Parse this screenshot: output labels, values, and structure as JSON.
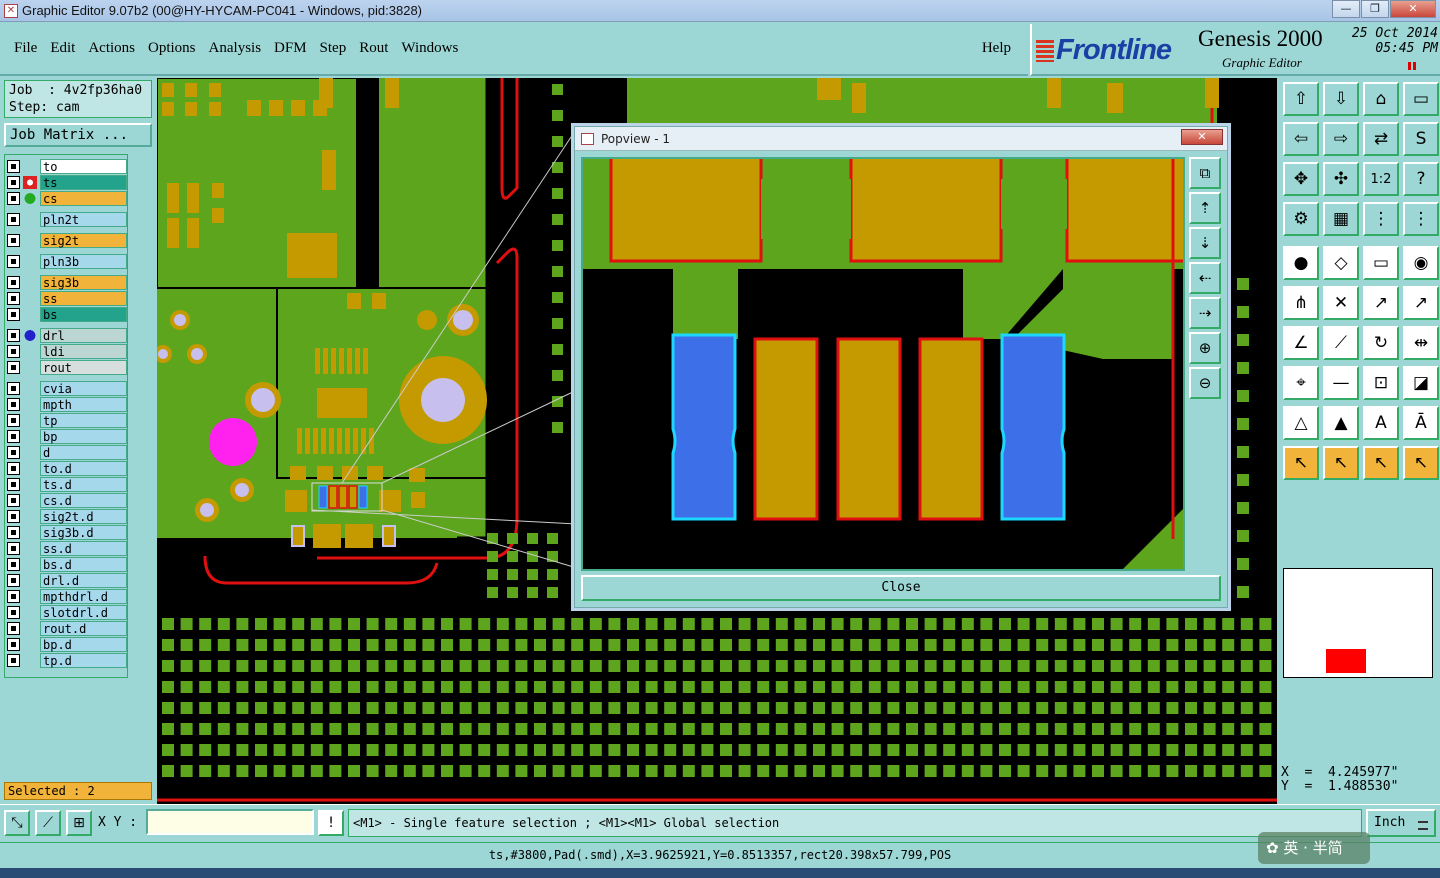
{
  "window": {
    "title": "Graphic Editor 9.07b2 (00@HY-HYCAM-PC041 - Windows, pid:3828)",
    "min": "—",
    "max": "❐",
    "close": "✕"
  },
  "menu": {
    "file": "File",
    "edit": "Edit",
    "actions": "Actions",
    "options": "Options",
    "analysis": "Analysis",
    "dfm": "DFM",
    "step": "Step",
    "rout": "Rout",
    "windows": "Windows",
    "help": "Help"
  },
  "brand": {
    "logo": "Frontline",
    "product": "Genesis 2000",
    "subtitle": "Graphic Editor",
    "date": "25 Oct 2014",
    "time": "05:45 PM"
  },
  "job": {
    "job_line": "Job  : 4v2fp36ha0",
    "step_line": "Step: cam",
    "matrix_label": "Job Matrix ..."
  },
  "layers": [
    {
      "name": "to",
      "color": "#ffffff"
    },
    {
      "name": "ts",
      "color": "#24a38c"
    },
    {
      "name": "cs",
      "color": "#f2b33a"
    },
    {
      "name": "pln2t",
      "color": "#a6d8ec"
    },
    {
      "name": "sig2t",
      "color": "#f2b33a"
    },
    {
      "name": "pln3b",
      "color": "#a6d8ec"
    },
    {
      "name": "sig3b",
      "color": "#f2b33a"
    },
    {
      "name": "ss",
      "color": "#f2b33a"
    },
    {
      "name": "bs",
      "color": "#24a38c"
    },
    {
      "name": "drl",
      "color": "#bcd6d3"
    },
    {
      "name": "ldi",
      "color": "#bcd6d3"
    },
    {
      "name": "rout",
      "color": "#d7dede"
    },
    {
      "name": "cvia",
      "color": "#a6d8ec"
    },
    {
      "name": "mpth",
      "color": "#a6d8ec"
    },
    {
      "name": "tp",
      "color": "#a6d8ec"
    },
    {
      "name": "bp",
      "color": "#a6d8ec"
    },
    {
      "name": "d",
      "color": "#a6d8ec"
    },
    {
      "name": "to.d",
      "color": "#a6d8ec"
    },
    {
      "name": "ts.d",
      "color": "#a6d8ec"
    },
    {
      "name": "cs.d",
      "color": "#a6d8ec"
    },
    {
      "name": "sig2t.d",
      "color": "#a6d8ec"
    },
    {
      "name": "sig3b.d",
      "color": "#a6d8ec"
    },
    {
      "name": "ss.d",
      "color": "#a6d8ec"
    },
    {
      "name": "bs.d",
      "color": "#a6d8ec"
    },
    {
      "name": "drl.d",
      "color": "#a6d8ec"
    },
    {
      "name": "mpthdrl.d",
      "color": "#a6d8ec"
    },
    {
      "name": "slotdrl.d",
      "color": "#a6d8ec"
    },
    {
      "name": "rout.d",
      "color": "#a6d8ec"
    },
    {
      "name": "bp.d",
      "color": "#a6d8ec"
    },
    {
      "name": "tp.d",
      "color": "#a6d8ec"
    }
  ],
  "selected": "Selected : 2",
  "popup": {
    "title": "Popview - 1",
    "close_x": "✕",
    "close_button": "Close"
  },
  "coords": {
    "x": "X  =  4.245977\"",
    "y": "Y  =  1.488530\""
  },
  "command": {
    "xy_label": "X Y :",
    "xy_value": "",
    "alert": "!",
    "message": "<M1> - Single feature selection ; <M1><M1> Global selection",
    "unit": "Inch"
  },
  "status": "ts,#3800,Pad(.smd),X=3.9625921,Y=0.8513357,rect20.398x57.799,POS",
  "watermark": "✿ 英 · 半简",
  "colors": {
    "board_green": "#5ca51c",
    "pad_gold": "#c49a00",
    "outline_red": "#e01010",
    "selected_blue": "#3d6fe8",
    "via_lavender": "#c7c0ee",
    "magenta": "#ff22ee",
    "ui_teal": "#9cd7d5"
  }
}
